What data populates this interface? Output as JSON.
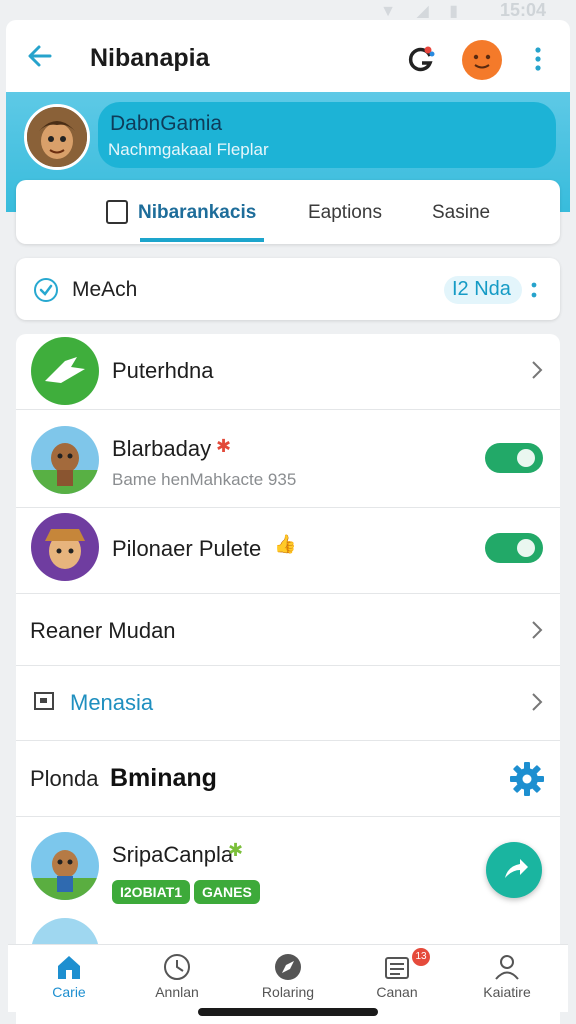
{
  "status_bar": {
    "time": "15:04",
    "icons": "▼ ◢ ▮"
  },
  "header": {
    "title": "Nibanapia",
    "back_icon": "arrow-left-icon",
    "colors": {
      "accent": "#26a3cc",
      "avatar_button": "#f47a2a"
    }
  },
  "profile": {
    "name": "DabnGamia",
    "subtitle": "Nachmgakaal Fleplar"
  },
  "tabs": [
    {
      "label": "Nibarankacis",
      "active": true
    },
    {
      "label": "Eaptions",
      "active": false
    },
    {
      "label": "Sasine",
      "active": false
    }
  ],
  "match_bar": {
    "label": "MeAch",
    "badge": "I2 Nda"
  },
  "rows": [
    {
      "title": "Puterhdna",
      "control": "chevron"
    },
    {
      "title": "Blarbaday",
      "subtitle": "Bame henMahkacte 935",
      "control": "toggle",
      "toggle_on": true,
      "badge": "✱"
    },
    {
      "title": "Pilonaer Pulete",
      "control": "toggle",
      "toggle_on": true,
      "badge": "👍"
    },
    {
      "title": "Reaner Mudan",
      "control": "chevron"
    },
    {
      "title": "Menasia",
      "control": "chevron"
    }
  ],
  "section": {
    "prefix": "Plonda",
    "title": "Bminang"
  },
  "featured": {
    "title": "SripaCanpla",
    "badge": "✱",
    "tags": [
      "I2OBIAT1",
      "GANES"
    ]
  },
  "bottom_nav": [
    {
      "label": "Carie",
      "icon": "home-icon",
      "active": true
    },
    {
      "label": "Annlan",
      "icon": "clock-icon",
      "active": false
    },
    {
      "label": "Rolaring",
      "icon": "compass-icon",
      "active": false
    },
    {
      "label": "Canan",
      "icon": "news-icon",
      "active": false,
      "badge": "13"
    },
    {
      "label": "Kaiatire",
      "icon": "person-icon",
      "active": false
    }
  ]
}
